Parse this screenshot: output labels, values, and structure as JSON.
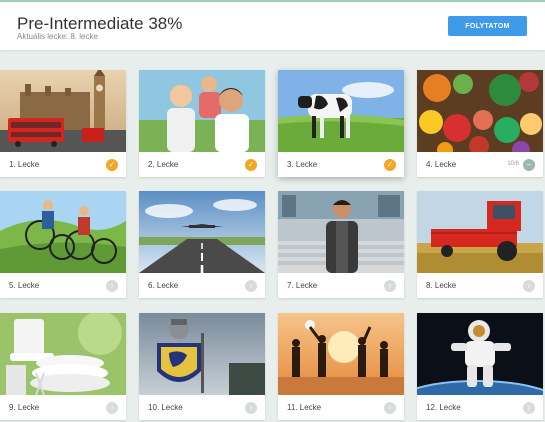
{
  "header": {
    "title": "Pre-Intermediate 38%",
    "subtitle": "Aktuális lecke: 8. lecke",
    "continue_button": "FOLYTATOM"
  },
  "colors": {
    "accent_button": "#3d9be9",
    "completed_badge": "#f5a623",
    "locked_badge": "#d7dcda",
    "background": "#e7eeeb"
  },
  "lessons": [
    {
      "label": "1. Lecke",
      "status": "completed",
      "status_icon": "check-icon",
      "image": "london-bus-big-ben"
    },
    {
      "label": "2. Lecke",
      "status": "completed",
      "status_icon": "check-icon",
      "image": "family-portrait"
    },
    {
      "label": "3. Lecke",
      "status": "completed",
      "status_icon": "check-icon",
      "image": "cow-in-field"
    },
    {
      "label": "4. Lecke",
      "status": "in-progress",
      "status_icon": "progress-icon",
      "progress": "10/6",
      "image": "vegetables"
    },
    {
      "label": "5. Lecke",
      "status": "locked",
      "status_icon": "chevron-right-icon",
      "image": "cyclists"
    },
    {
      "label": "6. Lecke",
      "status": "locked",
      "status_icon": "chevron-right-icon",
      "image": "airplane-runway"
    },
    {
      "label": "7. Lecke",
      "status": "locked",
      "status_icon": "chevron-right-icon",
      "image": "student-stairs"
    },
    {
      "label": "8. Lecke",
      "status": "locked",
      "status_icon": "chevron-right-icon",
      "image": "combine-harvester"
    },
    {
      "label": "9. Lecke",
      "status": "locked",
      "status_icon": "chevron-right-icon",
      "image": "dishes"
    },
    {
      "label": "10. Lecke",
      "status": "locked",
      "status_icon": "chevron-right-icon",
      "image": "knight-shield"
    },
    {
      "label": "11. Lecke",
      "status": "locked",
      "status_icon": "chevron-right-icon",
      "image": "beach-volleyball"
    },
    {
      "label": "12. Lecke",
      "status": "locked",
      "status_icon": "chevron-right-icon",
      "image": "astronaut"
    }
  ]
}
